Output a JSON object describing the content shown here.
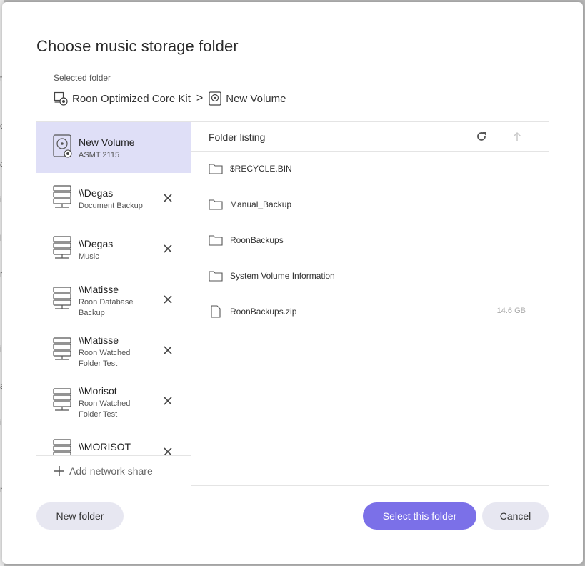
{
  "background": {
    "chars": [
      "t",
      "e",
      "a",
      "i",
      "l",
      "r",
      "i",
      "a",
      "i",
      "n"
    ]
  },
  "dialog": {
    "title": "Choose music storage folder",
    "selected_label": "Selected folder",
    "breadcrumb": [
      {
        "label": "Roon Optimized Core Kit",
        "icon": "core-kit-icon"
      },
      {
        "label": "New Volume",
        "icon": "drive-icon"
      }
    ],
    "breadcrumb_separator": ">"
  },
  "sidebar": {
    "items": [
      {
        "name": "New Volume",
        "sub": "ASMT 2115",
        "icon": "drive-icon",
        "selected": true,
        "removable": false
      },
      {
        "name": "\\\\Degas",
        "sub": "Document Backup",
        "icon": "server-icon",
        "selected": false,
        "removable": true
      },
      {
        "name": "\\\\Degas",
        "sub": "Music",
        "icon": "server-icon",
        "selected": false,
        "removable": true
      },
      {
        "name": "\\\\Matisse",
        "sub": "Roon Database Backup",
        "icon": "server-icon",
        "selected": false,
        "removable": true
      },
      {
        "name": "\\\\Matisse",
        "sub": "Roon Watched Folder Test",
        "icon": "server-icon",
        "selected": false,
        "removable": true
      },
      {
        "name": "\\\\Morisot",
        "sub": "Roon Watched Folder Test",
        "icon": "server-icon",
        "selected": false,
        "removable": true
      },
      {
        "name": "\\\\MORISOT",
        "sub": "",
        "icon": "server-icon",
        "selected": false,
        "removable": true
      }
    ],
    "add_share_label": "Add network share"
  },
  "listing": {
    "title": "Folder listing",
    "rows": [
      {
        "name": "$RECYCLE.BIN",
        "type": "folder",
        "size": ""
      },
      {
        "name": "Manual_Backup",
        "type": "folder",
        "size": ""
      },
      {
        "name": "RoonBackups",
        "type": "folder",
        "size": ""
      },
      {
        "name": "System Volume Information",
        "type": "folder",
        "size": ""
      },
      {
        "name": "RoonBackups.zip",
        "type": "file",
        "size": "14.6 GB"
      }
    ]
  },
  "buttons": {
    "new_folder": "New folder",
    "select": "Select this folder",
    "cancel": "Cancel"
  },
  "colors": {
    "accent": "#7b70e8",
    "selected_bg": "#dfdff7",
    "secondary_button": "#e7e7f1"
  }
}
